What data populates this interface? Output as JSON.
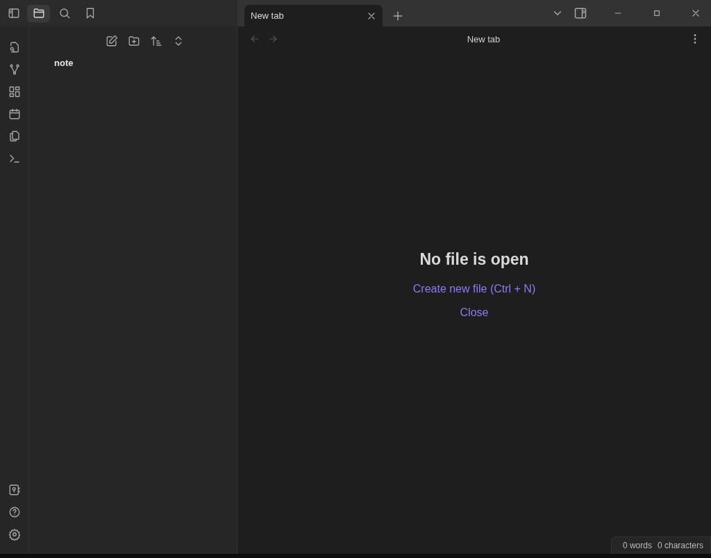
{
  "sidebar_tabs": [
    {
      "selected": true
    },
    {
      "selected": false
    },
    {
      "selected": false
    }
  ],
  "tabs": [
    {
      "label": "New tab",
      "selected": true
    }
  ],
  "file_explorer": {
    "items": [
      {
        "label": "note"
      }
    ]
  },
  "view": {
    "title": "New tab",
    "empty_state": {
      "heading": "No file is open",
      "actions": [
        "Create new file (Ctrl + N)",
        "Close"
      ]
    }
  },
  "status_bar": {
    "words": "0 words",
    "characters": "0 characters"
  }
}
